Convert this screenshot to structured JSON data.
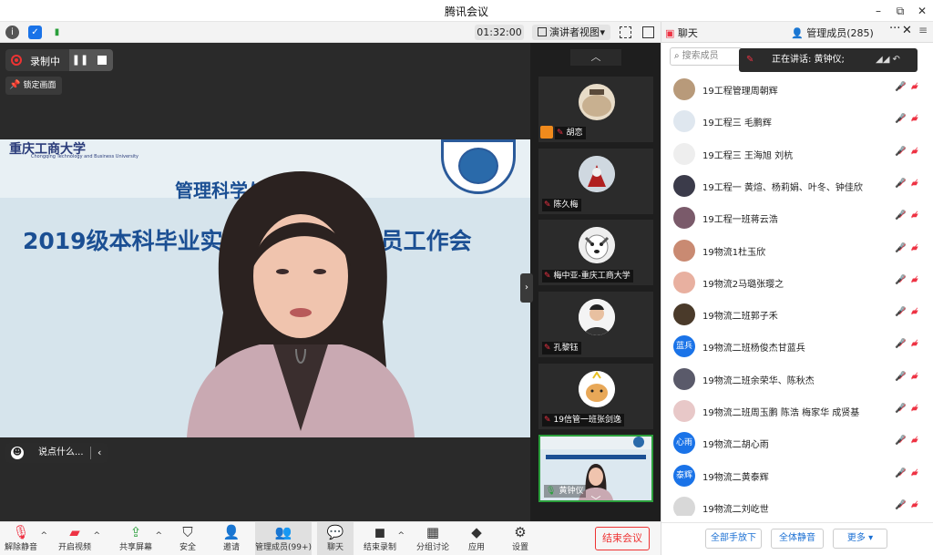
{
  "window": {
    "title": "腾讯会议",
    "min": "–",
    "restore": "⧉",
    "close": "✕"
  },
  "infobar": {
    "timer": "01:32:00",
    "view_mode": "演讲者视图",
    "view_caret": "▾"
  },
  "stage": {
    "recording_label": "录制中",
    "pause_glyph": "❚❚",
    "lock_label": "锁定画面",
    "video": {
      "school_name": "重庆工商大学",
      "school_en": "Chongqing Technology and Business University",
      "subtitle": "管理科学与",
      "headline": "2019级本科毕业实",
      "headline_tail": "动员工作会"
    },
    "chat_placeholder": "说点什么...",
    "chat_chevron": "‹",
    "collapse_chevron": "›"
  },
  "thumbs": {
    "up": "︿",
    "down": "﹀",
    "tiles": [
      {
        "name": "胡恋",
        "hand": true
      },
      {
        "name": "陈久梅"
      },
      {
        "name": "梅中亚-重庆工商大学"
      },
      {
        "name": "孔黎钰"
      },
      {
        "name": "19信管一班张剑逸"
      },
      {
        "name": "黄钟仪",
        "active": true
      }
    ]
  },
  "panel": {
    "tab_chat": "聊天",
    "tab_members": "管理成员(285)",
    "dots": "···",
    "close": "✕",
    "menu": "≡",
    "search_placeholder": "搜索成员",
    "speaking_label": "正在讲话: 黄钟仪;",
    "members": [
      {
        "name": "19工程管理周朝辉",
        "avatar": "",
        "color": "#b89a7a"
      },
      {
        "name": "19工程三 毛鹏辉",
        "avatar": "",
        "color": "#dfe7ef"
      },
      {
        "name": "19工程三 王海旭 刘杭",
        "avatar": "",
        "color": "#eeeeee"
      },
      {
        "name": "19工程一 黄煊、杨莉娟、叶冬、钟佳欣",
        "avatar": "",
        "color": "#3b3b4a"
      },
      {
        "name": "19工程一班蒋云浩",
        "avatar": "",
        "color": "#7a5a6a"
      },
      {
        "name": "19物流1杜玉欣",
        "avatar": "",
        "color": "#c98a72"
      },
      {
        "name": "19物流2马璐张璎之",
        "avatar": "",
        "color": "#e8b0a0"
      },
      {
        "name": "19物流二班郭子禾",
        "avatar": "",
        "color": "#4a3a2a"
      },
      {
        "name": "19物流二班杨俊杰甘蓝兵",
        "avatar": "蓝兵",
        "color": "#1a73e8"
      },
      {
        "name": "19物流二班余荣华、陈秋杰",
        "avatar": "",
        "color": "#5a5a6a"
      },
      {
        "name": "19物流二班周玉鹏 陈浩 梅家华 成贤基",
        "avatar": "",
        "color": "#e8c8c8"
      },
      {
        "name": "19物流二胡心雨",
        "avatar": "心雨",
        "color": "#1a73e8"
      },
      {
        "name": "19物流二黄泰辉",
        "avatar": "泰辉",
        "color": "#1a73e8"
      },
      {
        "name": "19物流二刘屹世",
        "avatar": "",
        "color": "#d8d8d8"
      }
    ],
    "footer": {
      "raise_all": "全部手放下",
      "mute_all": "全体静音",
      "more": "更多 ▾"
    }
  },
  "toolbar": {
    "buttons": [
      {
        "label": "解除静音",
        "icon": "🎙",
        "caret": "^"
      },
      {
        "label": "开启视频",
        "icon": "▰",
        "caret": "^"
      },
      {
        "label": "共享屏幕",
        "icon": "⇪",
        "caret": "^"
      },
      {
        "label": "安全",
        "icon": "⛉"
      },
      {
        "label": "邀请",
        "icon": "👤"
      },
      {
        "label": "管理成员(99+)",
        "icon": "👥"
      },
      {
        "label": "聊天",
        "icon": "💬"
      },
      {
        "label": "结束录制",
        "icon": "◼",
        "caret": "^"
      },
      {
        "label": "分组讨论",
        "icon": "▦"
      },
      {
        "label": "应用",
        "icon": "◆"
      },
      {
        "label": "设置",
        "icon": "⚙"
      }
    ],
    "end_meeting": "结束会议"
  }
}
